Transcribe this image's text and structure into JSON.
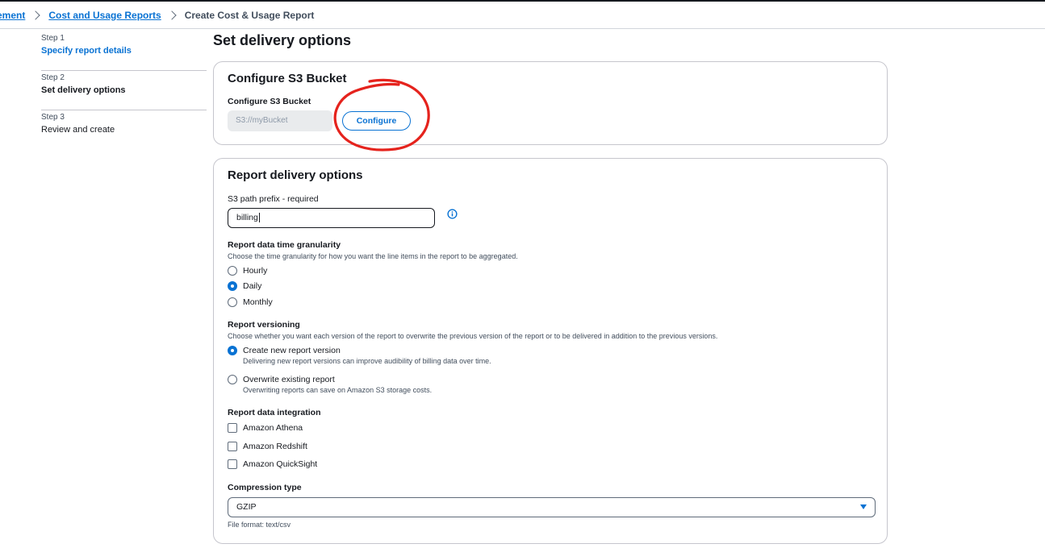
{
  "breadcrumb": {
    "items": [
      {
        "label": "ement"
      },
      {
        "label": "Cost and Usage Reports"
      }
    ],
    "current": "Create Cost & Usage Report"
  },
  "steps": [
    {
      "num": "Step 1",
      "title": "Specify report details"
    },
    {
      "num": "Step 2",
      "title": "Set delivery options"
    },
    {
      "num": "Step 3",
      "title": "Review and create"
    }
  ],
  "page": {
    "title": "Set delivery options"
  },
  "s3": {
    "card_title": "Configure S3 Bucket",
    "field_label": "Configure S3 Bucket",
    "placeholder": "S3://myBucket",
    "configure_label": "Configure"
  },
  "report": {
    "card_title": "Report delivery options",
    "prefix_label": "S3 path prefix - required",
    "prefix_value": "billing",
    "granularity": {
      "label": "Report data time granularity",
      "desc": "Choose the time granularity for how you want the line items in the report to be aggregated.",
      "options": [
        "Hourly",
        "Daily",
        "Monthly"
      ],
      "selected": "Daily"
    },
    "versioning": {
      "label": "Report versioning",
      "desc": "Choose whether you want each version of the report to overwrite the previous version of the report or to be delivered in addition to the previous versions.",
      "options": [
        {
          "label": "Create new report version",
          "sub": "Delivering new report versions can improve audibility of billing data over time."
        },
        {
          "label": "Overwrite existing report",
          "sub": "Overwriting reports can save on Amazon S3 storage costs."
        }
      ],
      "selected": "Create new report version"
    },
    "integration": {
      "label": "Report data integration",
      "options": [
        "Amazon Athena",
        "Amazon Redshift",
        "Amazon QuickSight"
      ]
    },
    "compression": {
      "label": "Compression type",
      "value": "GZIP",
      "hint": "File format: text/csv"
    }
  },
  "colors": {
    "accent": "#0972d3",
    "annotation": "#e5231d",
    "border": "#c6c6cd",
    "text": "#16191f"
  },
  "icons": {
    "breadcrumb_separator": "chevron-right-icon",
    "info": "info-icon",
    "select": "caret-down-icon"
  }
}
